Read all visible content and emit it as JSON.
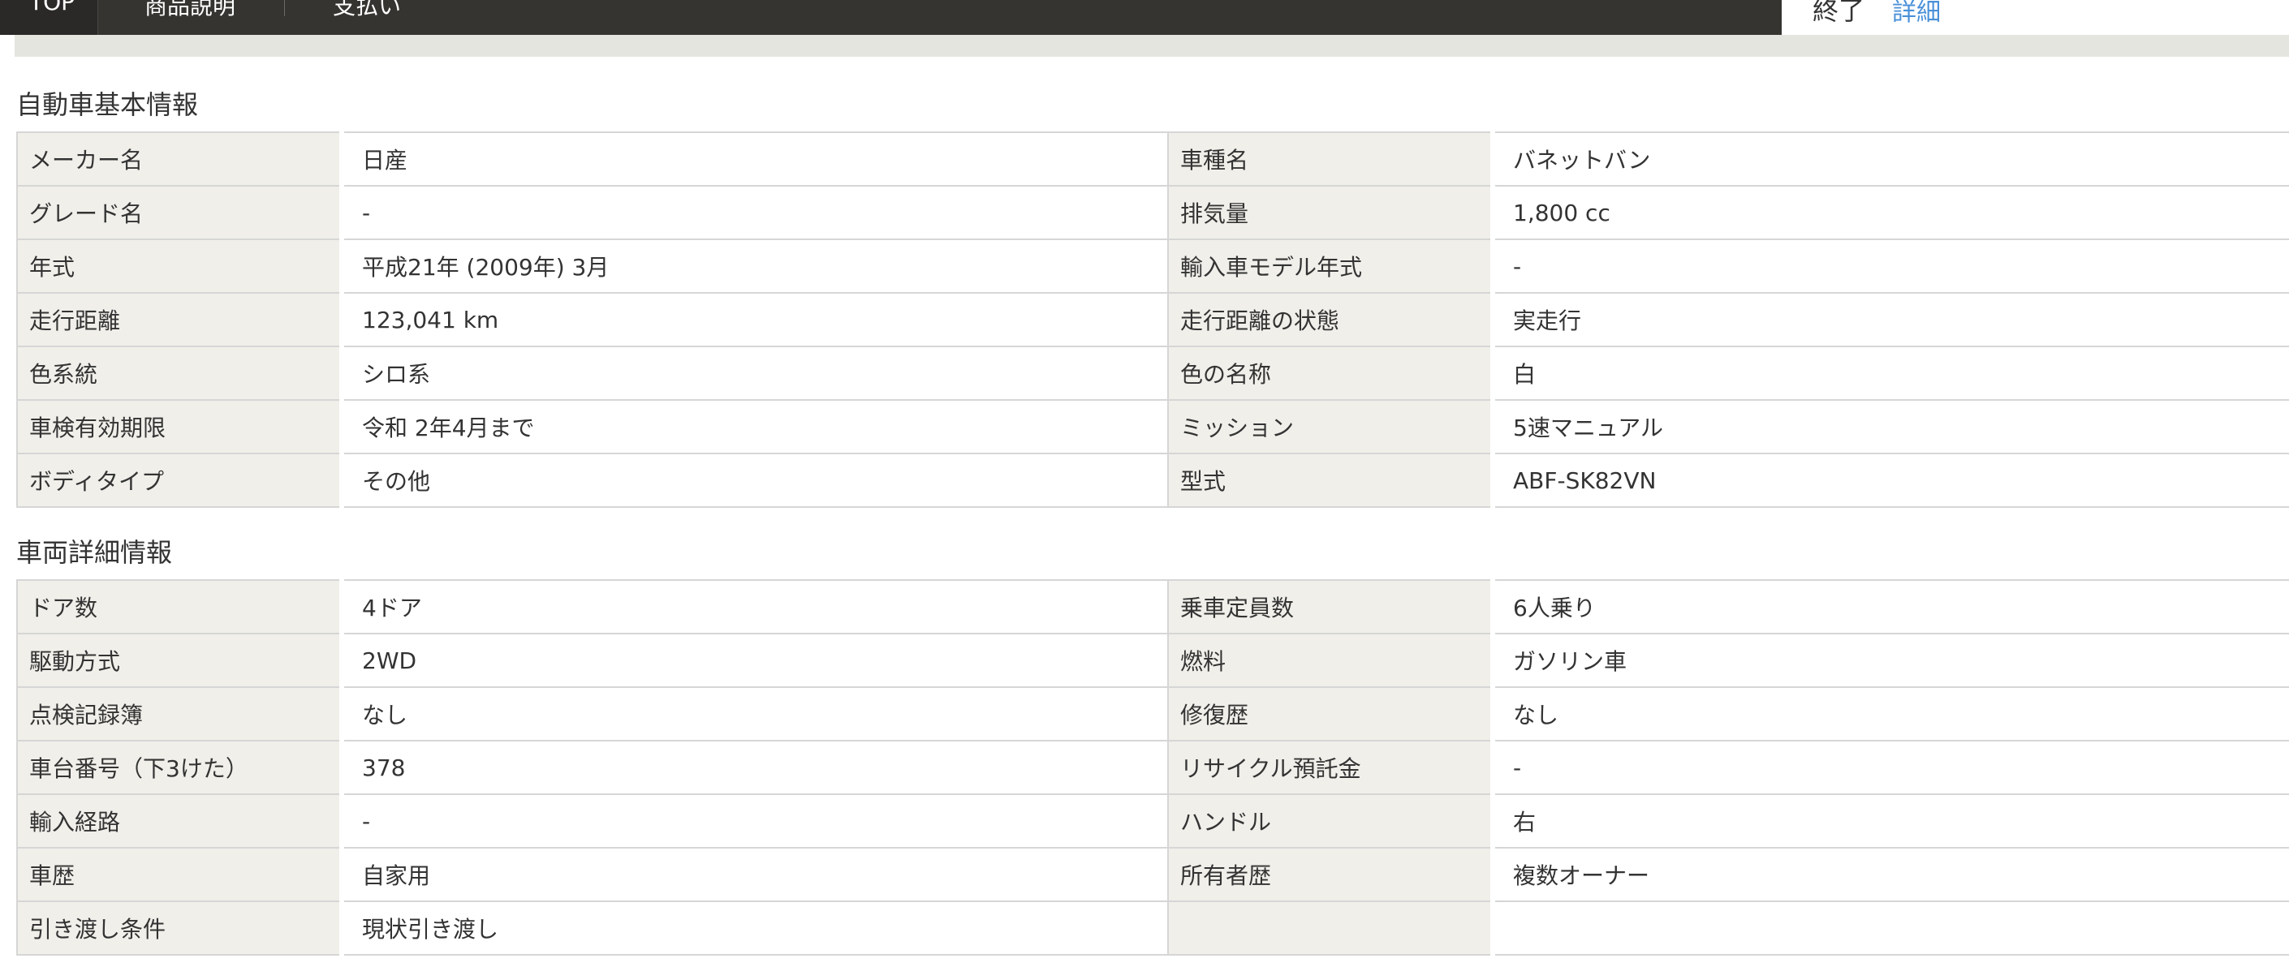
{
  "nav": {
    "tabs": [
      "TOP",
      "商品説明",
      "支払い"
    ],
    "status_text": "終了",
    "status_link": "詳細"
  },
  "basic": {
    "title": "自動車基本情報",
    "rows": [
      {
        "l1": "メーカー名",
        "v1": "日産",
        "l2": "車種名",
        "v2": "バネットバン"
      },
      {
        "l1": "グレード名",
        "v1": "-",
        "l2": "排気量",
        "v2": "1,800 cc"
      },
      {
        "l1": "年式",
        "v1": "平成21年 (2009年) 3月",
        "l2": "輸入車モデル年式",
        "v2": "-"
      },
      {
        "l1": "走行距離",
        "v1": "123,041 km",
        "l2": "走行距離の状態",
        "v2": "実走行"
      },
      {
        "l1": "色系統",
        "v1": "シロ系",
        "l2": "色の名称",
        "v2": "白"
      },
      {
        "l1": "車検有効期限",
        "v1": "令和 2年4月まで",
        "l2": "ミッション",
        "v2": "5速マニュアル"
      },
      {
        "l1": "ボディタイプ",
        "v1": "その他",
        "l2": "型式",
        "v2": "ABF-SK82VN"
      }
    ]
  },
  "detail": {
    "title": "車両詳細情報",
    "rows": [
      {
        "l1": "ドア数",
        "v1": "4ドア",
        "l2": "乗車定員数",
        "v2": "6人乗り"
      },
      {
        "l1": "駆動方式",
        "v1": "2WD",
        "l2": "燃料",
        "v2": "ガソリン車"
      },
      {
        "l1": "点検記録簿",
        "v1": "なし",
        "l2": "修復歴",
        "v2": "なし"
      },
      {
        "l1": "車台番号（下3けた）",
        "v1": "378",
        "l2": "リサイクル預託金",
        "v2": "-"
      },
      {
        "l1": "輸入経路",
        "v1": "-",
        "l2": "ハンドル",
        "v2": "右"
      },
      {
        "l1": "車歴",
        "v1": "自家用",
        "l2": "所有者歴",
        "v2": "複数オーナー"
      },
      {
        "l1": "引き渡し条件",
        "v1": "現状引き渡し",
        "l2": "",
        "v2": ""
      }
    ]
  }
}
